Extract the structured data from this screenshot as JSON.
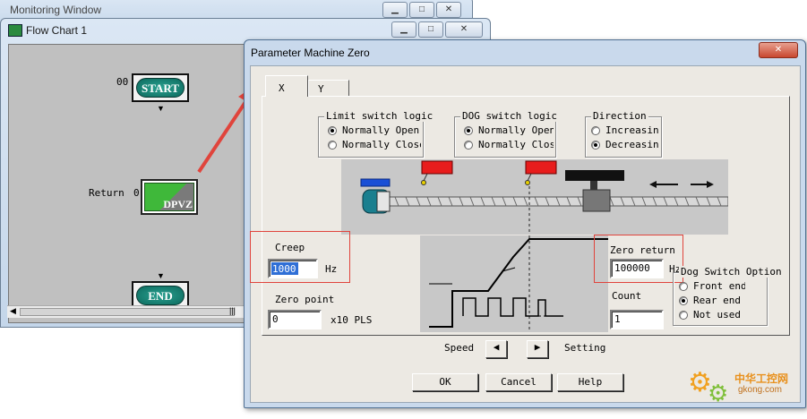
{
  "monitoring_window": {
    "title": "Monitoring Window"
  },
  "flowchart_window": {
    "title": "Flow Chart 1",
    "nodes": {
      "start": {
        "index": "00",
        "label": "START"
      },
      "return": {
        "prefix": "Return",
        "index": "0",
        "label": "DPVZ"
      },
      "end": {
        "label": "END"
      }
    }
  },
  "dialog": {
    "title": "Parameter Machine Zero",
    "tabs": [
      "X",
      "Y"
    ],
    "limit_switch_logic": {
      "title": "Limit switch logic",
      "options": [
        "Normally Open",
        "Normally Close"
      ],
      "selected": 0
    },
    "dog_switch_logic": {
      "title": "DOG switch logic",
      "options": [
        "Normally Open",
        "Normally Close"
      ],
      "selected": 0
    },
    "direction": {
      "title": "Direction",
      "options": [
        "Increasing",
        "Decreasing"
      ],
      "selected": 1
    },
    "creep": {
      "label": "Creep",
      "value": "1000",
      "unit": "Hz"
    },
    "zero_point": {
      "label": "Zero point",
      "value": "0",
      "unit": "x10 PLS"
    },
    "zero_return": {
      "label": "Zero return",
      "value": "100000",
      "unit": "Hz"
    },
    "count": {
      "label": "Count",
      "value": "1"
    },
    "dog_switch_option": {
      "title": "Dog Switch Option",
      "options": [
        "Front end",
        "Rear end",
        "Not used"
      ],
      "selected": 1
    },
    "speed_setting": {
      "left_label": "Speed",
      "right_label": "Setting"
    },
    "buttons": {
      "ok": "OK",
      "cancel": "Cancel",
      "help": "Help"
    }
  },
  "watermark": {
    "text": "中华工控网",
    "url": "gkong.com"
  },
  "colors": {
    "accent_red": "#e0443c",
    "node_teal": "#1a8a7a",
    "node_green": "#3fb83a",
    "dialog_bg": "#ece9e3"
  }
}
